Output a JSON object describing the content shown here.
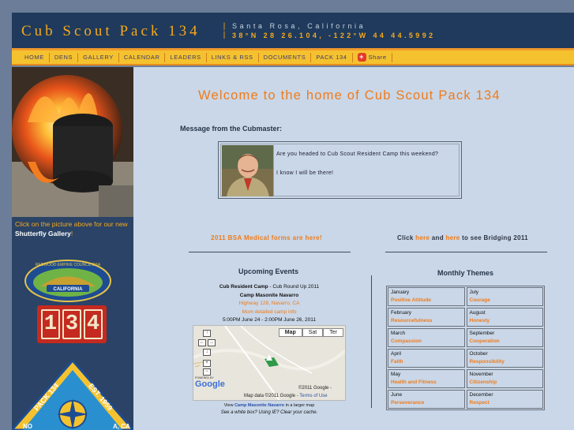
{
  "header": {
    "title": "Cub Scout Pack 134",
    "separator": "|",
    "location": "Santa Rosa, California",
    "coordinates": "38°N 28 26.104, -122°W 44 44.5992"
  },
  "nav": {
    "items": [
      "HOME",
      "DENS",
      "GALLERY",
      "CALENDAR",
      "LEADERS",
      "LINKS & RSS",
      "DOCUMENTS",
      "PACK 134"
    ],
    "share_label": "Share"
  },
  "sidebar": {
    "caption_prefix": "Click on the picture above for our new ",
    "caption_link": "Shutterfly Gallery",
    "caption_suffix": "!",
    "council_patch_text": "REDWOOD EMPIRE COUNCIL BSA",
    "council_patch_state": "CALIFORNIA",
    "pack_digits": [
      "1",
      "3",
      "4"
    ],
    "emblem_left": "PACK 134",
    "emblem_right": "EST. 1959",
    "emblem_bottom_left": "NO",
    "emblem_bottom_right": "A, CA"
  },
  "main": {
    "welcome": "Welcome to the home of Cub Scout Pack 134",
    "message_heading": "Message from the Cubmaster:",
    "message_line1": "Are you headed to Cub Scout Resident Camp this weekend?",
    "message_line2": "I know I will be there!",
    "medical_link": "2011 BSA Medical forms are here!",
    "bridging": {
      "prefix": "Click ",
      "here1": "here",
      "and": " and ",
      "here2": "here",
      "suffix": " to see Bridging 2011"
    }
  },
  "events": {
    "heading": "Upcoming Events",
    "event_title": "Cub Resident Camp",
    "event_subtitle": " - Cub Round Up 2011",
    "location": "Camp Masonite Navarro",
    "address": "Highway 128, Navarro, CA",
    "details_link": "Mom detailed camp info",
    "time": "5:00PM June 24 - 2:00PM June 26, 2011"
  },
  "map": {
    "type_buttons": [
      "Map",
      "Sat",
      "Ter"
    ],
    "powered_by": "POWERED BY",
    "google": "Google",
    "copyright": "©2011 Google -",
    "data_prefix": "Map data ©2011 Google - ",
    "terms": "Terms of Use",
    "caption_prefix": "View ",
    "caption_link": "Camp Masonite Navarro",
    "caption_suffix": " in a larger map",
    "warning": "See a white box? Using IE? Clear your cache."
  },
  "themes": {
    "heading": "Monthly Themes",
    "months": [
      {
        "month": "January",
        "theme": "Positive Attitude"
      },
      {
        "month": "July",
        "theme": "Courage"
      },
      {
        "month": "February",
        "theme": "Resourcefulness"
      },
      {
        "month": "August",
        "theme": "Honesty"
      },
      {
        "month": "March",
        "theme": "Compassion"
      },
      {
        "month": "September",
        "theme": "Cooperation"
      },
      {
        "month": "April",
        "theme": "Faith"
      },
      {
        "month": "October",
        "theme": "Responsibility"
      },
      {
        "month": "May",
        "theme": "Health and Fitness"
      },
      {
        "month": "November",
        "theme": "Citizenship"
      },
      {
        "month": "June",
        "theme": "Perseverance"
      },
      {
        "month": "December",
        "theme": "Respect"
      }
    ]
  },
  "colors": {
    "header_bg": "#1f3a5c",
    "accent_orange": "#f07b1a",
    "nav_yellow": "#f5c22f",
    "main_bg": "#c9d7e8"
  }
}
